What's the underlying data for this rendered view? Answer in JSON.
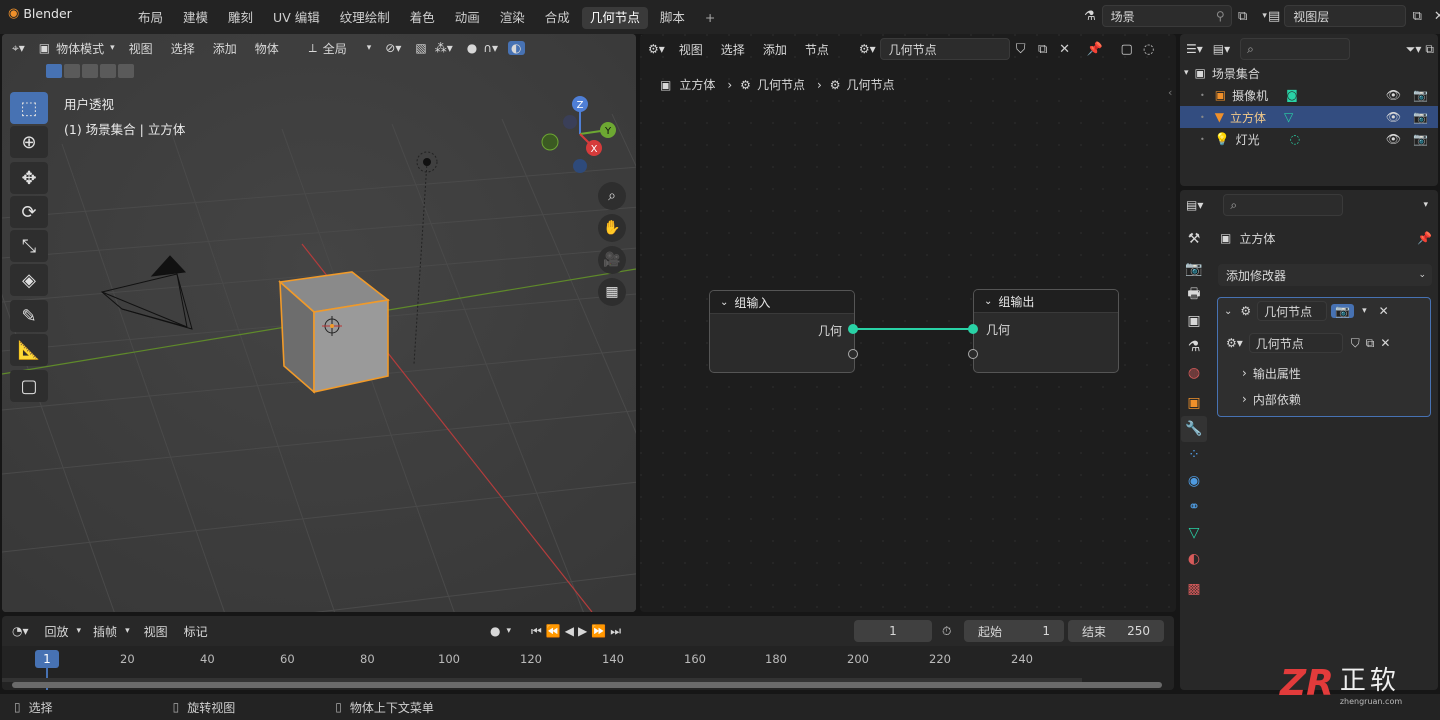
{
  "app": {
    "name": "Blender"
  },
  "workspaces": [
    {
      "label": "布局"
    },
    {
      "label": "建模"
    },
    {
      "label": "雕刻"
    },
    {
      "label": "UV 编辑"
    },
    {
      "label": "纹理绘制"
    },
    {
      "label": "着色"
    },
    {
      "label": "动画"
    },
    {
      "label": "渲染"
    },
    {
      "label": "合成"
    },
    {
      "label": "几何节点"
    },
    {
      "label": "脚本"
    }
  ],
  "topbar": {
    "scene": "场景",
    "view_layer": "视图层",
    "add_tab": "+"
  },
  "viewport": {
    "mode": "物体模式",
    "menu": [
      "视图",
      "选择",
      "添加",
      "物体"
    ],
    "transform": "全局",
    "overlay_title": "用户透视",
    "overlay_subtitle": "(1) 场景集合 | 立方体",
    "gizmo": {
      "z": "Z",
      "y": "Y",
      "x": "X"
    }
  },
  "node_editor": {
    "menu": [
      "视图",
      "选择",
      "添加",
      "节点"
    ],
    "tree_name": "几何节点",
    "breadcrumb": [
      "立方体",
      "几何节点",
      "几何节点"
    ],
    "nodes": {
      "input": {
        "title": "组输入",
        "socket": "几何"
      },
      "output": {
        "title": "组输出",
        "socket": "几何"
      }
    },
    "link_color": "#29d2a6"
  },
  "outliner": {
    "root": "场景集合",
    "items": [
      {
        "name": "摄像机",
        "selected": false
      },
      {
        "name": "立方体",
        "selected": true
      },
      {
        "name": "灯光",
        "selected": false
      }
    ]
  },
  "properties": {
    "object_name": "立方体",
    "add_modifier": "添加修改器",
    "modifier": {
      "name": "几何节点",
      "node_group": "几何节点",
      "sections": [
        "输出属性",
        "内部依赖"
      ]
    }
  },
  "timeline": {
    "menu": [
      "回放",
      "插帧",
      "视图",
      "标记"
    ],
    "current_frame": "1",
    "start_label": "起始",
    "start_value": "1",
    "end_label": "结束",
    "end_value": "250",
    "ruler": [
      "1",
      "20",
      "40",
      "60",
      "80",
      "100",
      "120",
      "140",
      "160",
      "180",
      "200",
      "220",
      "240"
    ]
  },
  "statusbar": {
    "left": "选择",
    "middle": "旋转视图",
    "right": "物体上下文菜单"
  },
  "watermark": {
    "text": "正软",
    "sub": "zhengruan.com",
    "logo": "ZR"
  },
  "colors": {
    "accent": "#4772b3",
    "selection": "#f09a2a",
    "link": "#29d2a6"
  }
}
